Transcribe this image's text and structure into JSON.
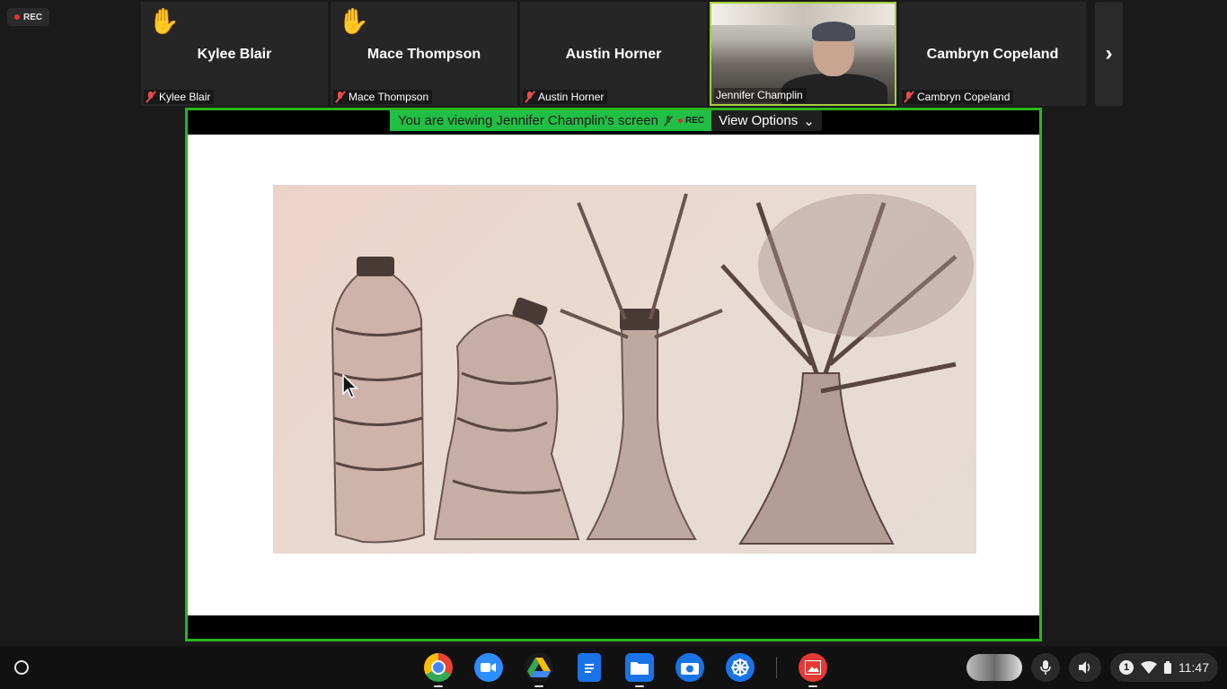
{
  "recording": {
    "label": "REC"
  },
  "participants": [
    {
      "tile_name": "Kylee Blair",
      "label": "Kylee Blair",
      "hand_raised": true,
      "muted": true
    },
    {
      "tile_name": "Mace Thompson",
      "label": "Mace Thompson",
      "hand_raised": true,
      "muted": true
    },
    {
      "tile_name": "Austin Horner",
      "label": "Austin Horner",
      "hand_raised": false,
      "muted": true
    },
    {
      "tile_name": "",
      "label": "Jennifer Champlin",
      "hand_raised": false,
      "muted": false,
      "video_on": true
    },
    {
      "tile_name": "Cambryn Copeland",
      "label": "Cambryn Copeland",
      "hand_raised": false,
      "muted": true
    }
  ],
  "icons": {
    "raised_hand": "✋",
    "next_arrow": "›",
    "view_options_chevron": "⌄"
  },
  "share_banner": {
    "text": "You are viewing Jennifer Champlin's screen",
    "rec": "REC",
    "view_options": "View Options"
  },
  "colors": {
    "active_speaker_border": "#a7ce3a",
    "share_border": "#2bb51d",
    "banner_green": "#21bf45",
    "muted_red": "#e84c4c"
  },
  "shelf": {
    "apps": [
      "chrome",
      "zoom",
      "google-drive",
      "google-docs",
      "files",
      "camera",
      "settings-wheel",
      "gallery"
    ],
    "notification_count": "1",
    "time": "11:47"
  }
}
